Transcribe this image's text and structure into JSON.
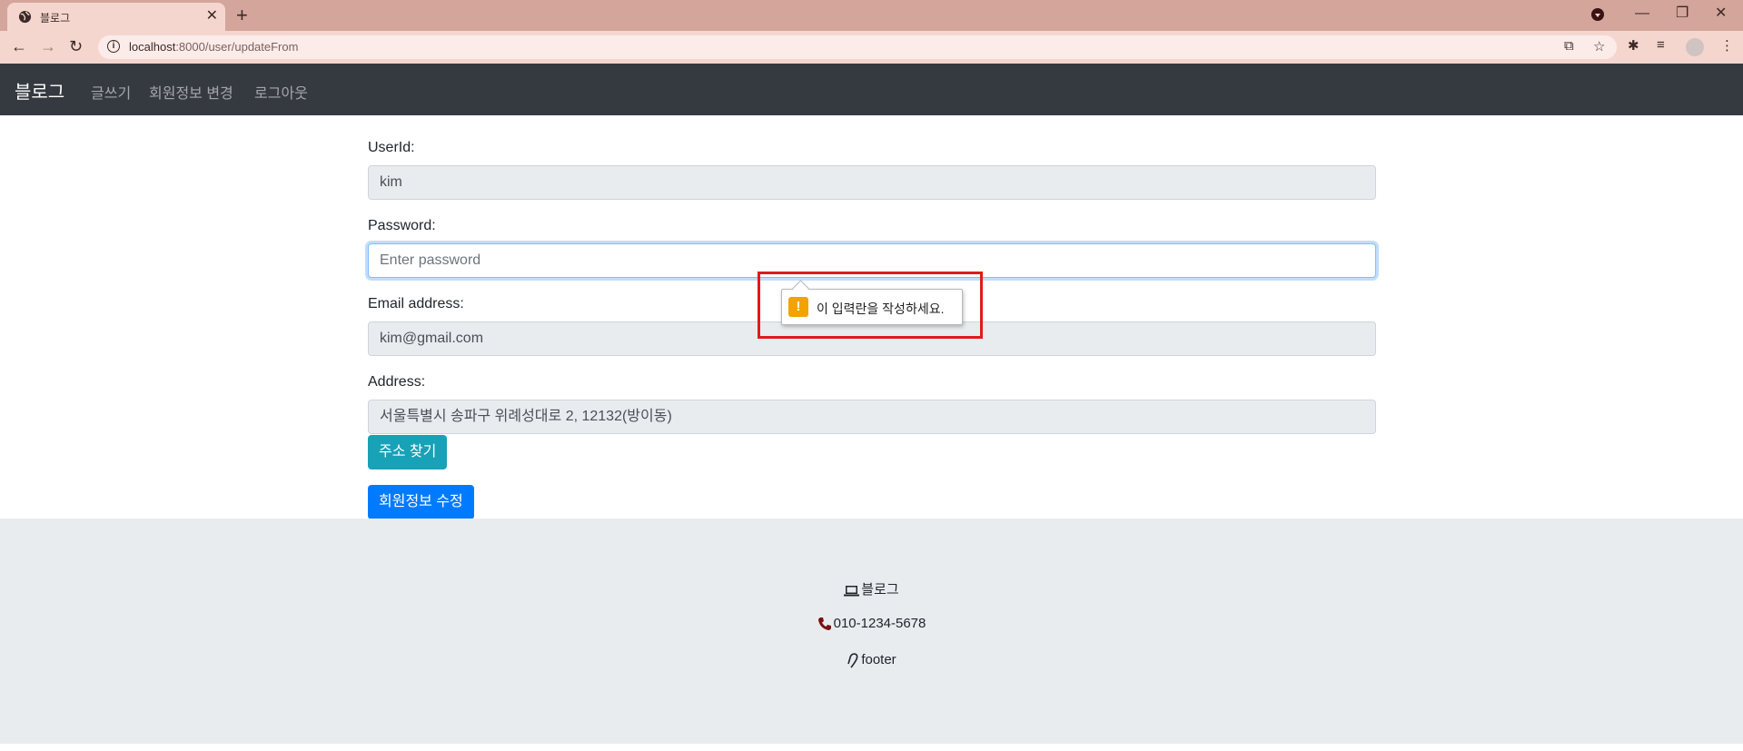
{
  "browser": {
    "tab_title": "블로그",
    "new_tab_label": "+",
    "url_host": "localhost",
    "url_path": ":8000/user/updateFrom"
  },
  "navbar": {
    "brand": "블로그",
    "links": [
      "글쓰기",
      "회원정보 변경",
      "로그아웃"
    ]
  },
  "form": {
    "userid_label": "UserId:",
    "userid_value": "kim",
    "password_label": "Password:",
    "password_placeholder": "Enter password",
    "email_label": "Email address:",
    "email_value": "kim@gmail.com",
    "address_label": "Address:",
    "address_value": "서울특별시 송파구 위례성대로 2, 12132(방이동)",
    "find_address_button": "주소 찾기",
    "submit_button": "회원정보 수정"
  },
  "validation_tooltip": {
    "message": "이 입력란을 작성하세요.",
    "icon": "warning-icon",
    "color": "#f2a300"
  },
  "footer": {
    "brand": "블로그",
    "phone": "010-1234-5678",
    "note": "footer"
  },
  "colors": {
    "navbar_bg": "#343a40",
    "primary": "#007bff",
    "info": "#17a2b8",
    "footer_bg": "#e9ecef",
    "highlight": "#e01b1b"
  }
}
